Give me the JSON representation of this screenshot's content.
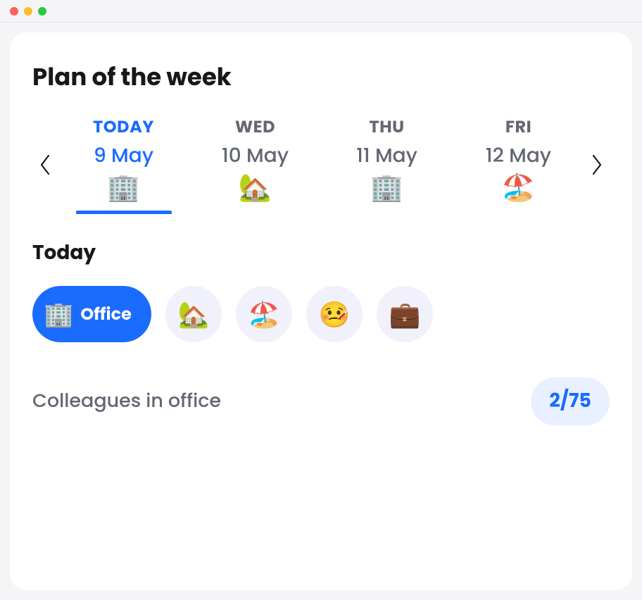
{
  "header": {
    "title": "Plan of the week"
  },
  "week": {
    "days": [
      {
        "label": "TODAY",
        "date": "9 May",
        "icon": "🏢",
        "active": true
      },
      {
        "label": "WED",
        "date": "10 May",
        "icon": "🏡",
        "active": false
      },
      {
        "label": "THU",
        "date": "11 May",
        "icon": "🏢",
        "active": false
      },
      {
        "label": "FRI",
        "date": "12 May",
        "icon": "🏖️",
        "active": false
      }
    ]
  },
  "today": {
    "heading": "Today",
    "selected": {
      "icon": "🏢",
      "label": "Office"
    },
    "options": [
      {
        "icon": "🏡",
        "name": "home"
      },
      {
        "icon": "🏖️",
        "name": "vacation"
      },
      {
        "icon": "🤒",
        "name": "sick"
      },
      {
        "icon": "💼",
        "name": "business-trip"
      }
    ]
  },
  "colleagues": {
    "label": "Colleagues in office",
    "count": "2/75"
  }
}
